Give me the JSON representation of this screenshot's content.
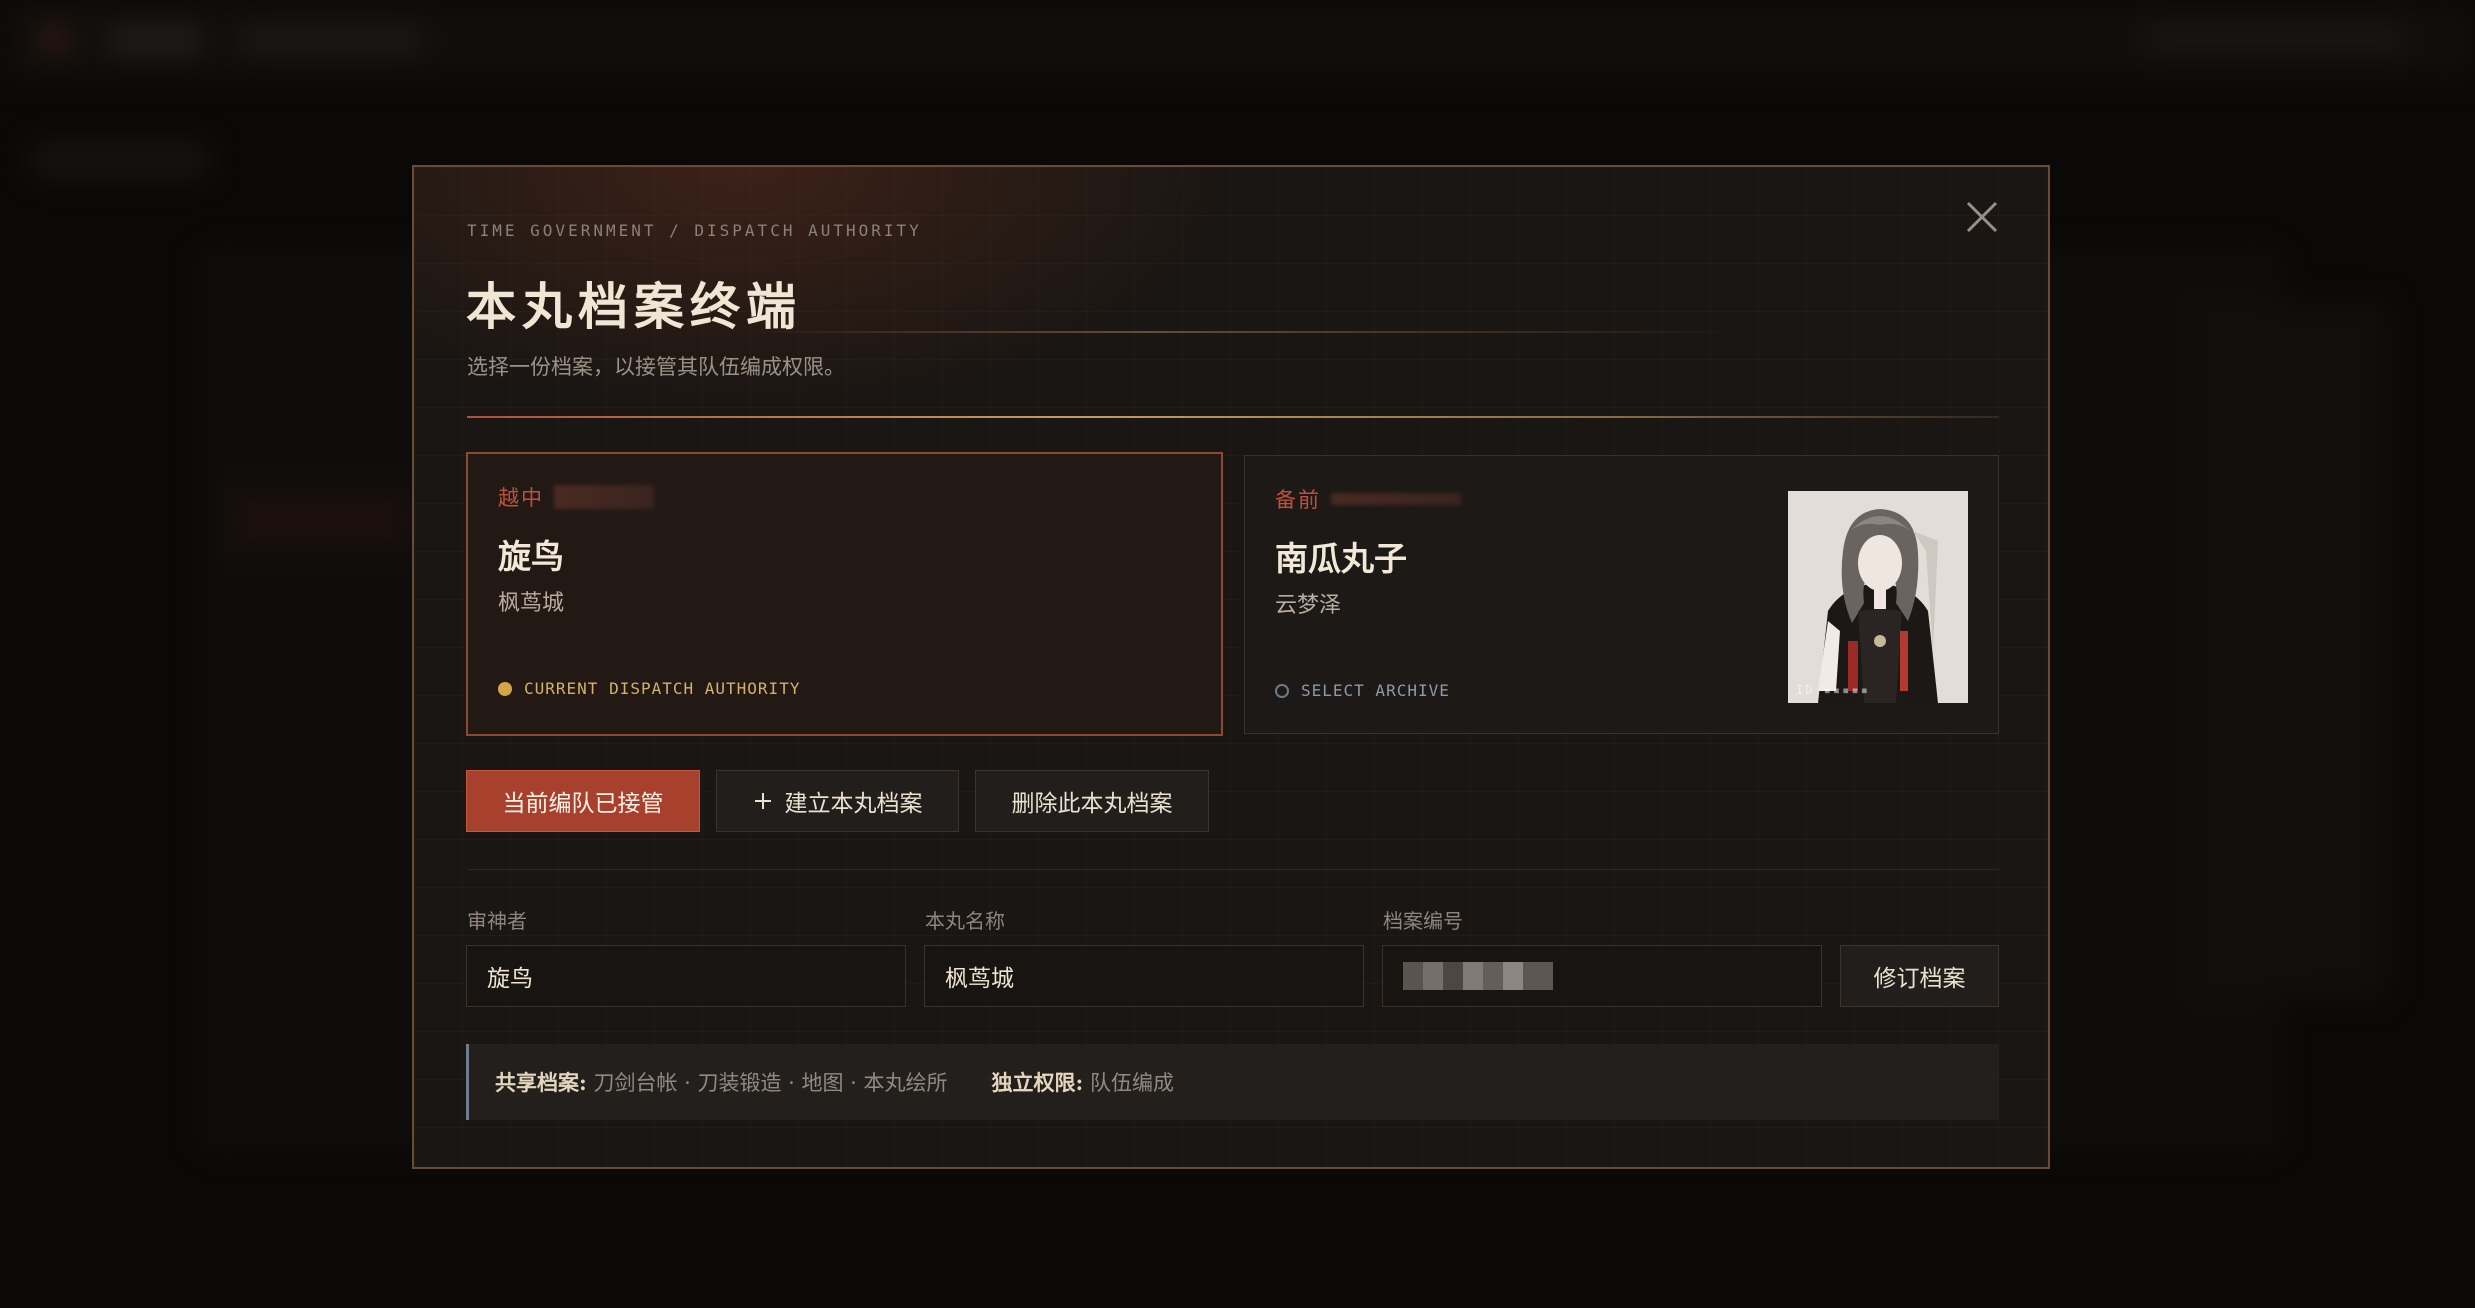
{
  "modal": {
    "eyebrow": "TIME GOVERNMENT / DISPATCH AUTHORITY",
    "title": "本丸档案终端",
    "subtitle": "选择一份档案，以接管其队伍编成权限。",
    "close_icon": "close-icon"
  },
  "cards": [
    {
      "region": "越中",
      "name": "旋鸟",
      "castle": "枫茑城",
      "status": "CURRENT DISPATCH AUTHORITY",
      "active": true
    },
    {
      "region": "备前",
      "name": "南瓜丸子",
      "castle": "云梦泽",
      "status": "SELECT ARCHIVE",
      "active": false,
      "has_portrait": true
    }
  ],
  "actions": {
    "takeover_label": "当前编队已接管",
    "create_label": "建立本丸档案",
    "create_icon": "plus-icon",
    "delete_label": "删除此本丸档案"
  },
  "form": {
    "saniwa_label": "审神者",
    "saniwa_value": "旋鸟",
    "citadel_label": "本丸名称",
    "citadel_value": "枫茑城",
    "archive_id_label": "档案编号",
    "revise_label": "修订档案"
  },
  "info": {
    "shared_key": "共享档案:",
    "shared_value": "刀剑台帐 · 刀装锻造 · 地图 · 本丸绘所",
    "independent_key": "独立权限:",
    "independent_value": "队伍编成"
  },
  "colors": {
    "accent_red": "#a8402e",
    "gold": "#d4a64a",
    "border_brown": "#6b4a32"
  }
}
